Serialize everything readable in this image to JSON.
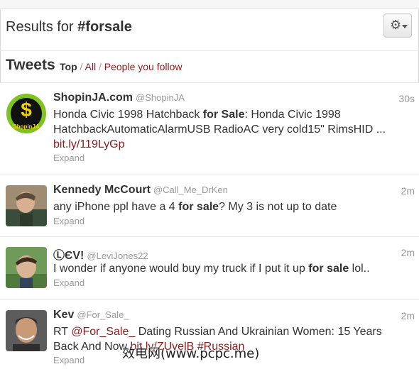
{
  "header": {
    "results_prefix": "Results for",
    "hashtag": "#forsale",
    "gear_icon": "gear-icon"
  },
  "section": {
    "title": "Tweets",
    "filter_top": "Top",
    "filter_all": "All",
    "filter_people": "People you follow"
  },
  "tweets": [
    {
      "name": "ShopinJA.com",
      "handle": "@ShopinJA",
      "time": "30s",
      "text_a": "Honda Civic 1998 Hatchback ",
      "bold_a": "for Sale",
      "text_b": ": Honda Civic 1998 HatchbackAutomaticAlarmUSB RadioAC very cold15\" RimsHID ...",
      "link": "bit.ly/119LyGp",
      "avatar_text": "ShopinJA",
      "expand": "Expand"
    },
    {
      "name": "Kennedy McCourt",
      "handle": "@Call_Me_DrKen",
      "time": "2m",
      "text_a": "any iPhone ppl have a 4 ",
      "bold_a": "for sale",
      "text_b": "? My 3 is not up to date",
      "expand": "Expand"
    },
    {
      "name": "ⓁЄV!",
      "handle": "@LeviJones22",
      "time": "2m",
      "text_a": "I wonder if anyone would buy my truck if I put it up ",
      "bold_a": "for sale",
      "text_b": " lol..",
      "expand": "Expand"
    },
    {
      "name": "Kev",
      "handle": "@For_Sale_",
      "time": "2m",
      "text_a": "RT ",
      "mention": "@For_Sale_",
      "text_b": " Dating Russian And Ukrainian Women: 15 Years Back And Now ",
      "link": "bit.ly/ZUvelB",
      "hashtag": "#Russian",
      "expand": "Expand"
    }
  ],
  "watermark": "效电网(www.pcpc.me)",
  "colors": {
    "link": "#8b1a1a",
    "muted": "#999999",
    "text": "#333333",
    "shopin_green": "#7ec31f"
  }
}
